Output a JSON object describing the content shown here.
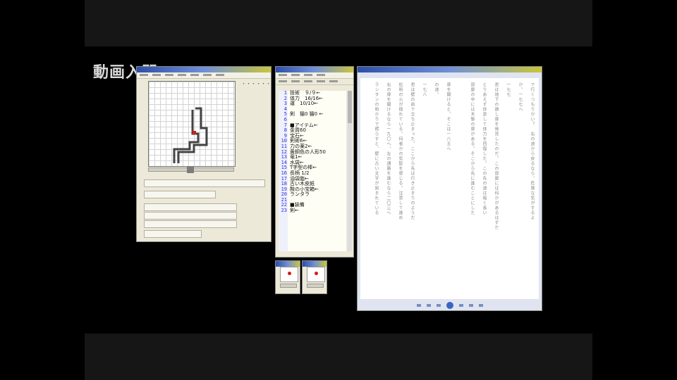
{
  "logo": {
    "text": "動画入門",
    "subtitle": ""
  },
  "map_editor": {
    "title": "",
    "menu": [
      "",
      "",
      "",
      "",
      "",
      "",
      ""
    ],
    "glyph_palette": "・・・・・・・・・・・・・・・・・・・・・・・・・・・・・・・・・・・・・・・・"
  },
  "text_editor": {
    "title": "",
    "line_numbers": [
      "1",
      "2",
      "3",
      "4",
      "5",
      "6",
      "7",
      "8",
      "9",
      "10",
      "11",
      "12",
      "13",
      "14",
      "15",
      "16",
      "17",
      "18",
      "19",
      "20",
      "21",
      "22",
      "23"
    ],
    "lines": [
      "技術　９/９←",
      "体力　16/16←",
      "運　10/10←",
      "",
      "剣　猫0 猫0 ←",
      "",
      "■アイテム←",
      "金貨60",
      "宝石←",
      "剣術6←",
      "力の薬2←",
      "黄銅色の人形50",
      "竜1←",
      "水袋←",
      "T字型の棒←",
      "長柄 1/2",
      "油袋脂←",
      "古い木皮紙",
      "酸の小宝箱←",
      "ランタラ",
      "",
      "■装備",
      "剣←"
    ]
  },
  "reader": {
    "title": "",
    "columns": [
      "で行くつもりかい？　右の道から戻るなら、危険な気がするよ",
      "か。一七七へ",
      "一七七",
      "君は地下の隠し扉を発見したのだ。この部屋には何かがあるはずだ",
      "とりあえず休息して体力を回復した。この先の道は暗く長い",
      "部屋の中には木製の扉がある。そこから先に進むことにした",
      "",
      "扉を開けると、そこは一八五へ",
      "の道。",
      "一七八",
      "君は壁の前で立ち止まった。ここから先は行き止まりのようだ",
      "松明の火が揺れている。何者かの気配を感じる。注意して進め",
      "右の扉を開けるなら一九〇へ、左の通路を進むなら二〇三へ",
      "ランタンの明かりで照らすと、壁に古い文字が刻まれている"
    ]
  },
  "mini_window_left": {
    "title": ""
  },
  "mini_window_right": {
    "title": ""
  },
  "colors": {
    "background": "#000000",
    "window_face": "#ece9d8",
    "titlebar": "#2c4fa8",
    "line_number": "#2b2be0",
    "record": "#d21b1b",
    "logo_accent": "#e7a21b"
  }
}
